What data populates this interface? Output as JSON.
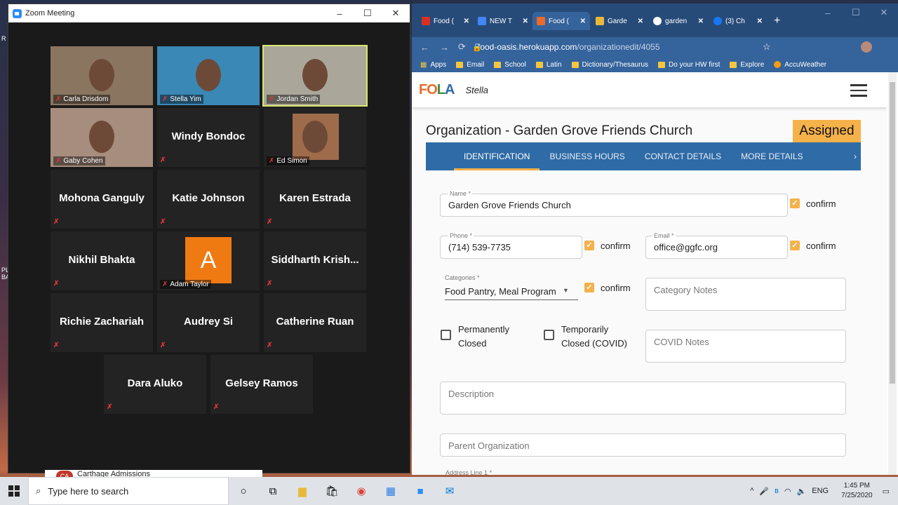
{
  "zoom": {
    "title": "Zoom Meeting",
    "participants": [
      {
        "name": "Carla Drisdom",
        "video": true
      },
      {
        "name": "Stella Yim",
        "video": true
      },
      {
        "name": "Jordan Smith",
        "video": true,
        "speaking": true
      },
      {
        "name": "Gaby Cohen",
        "video": true
      },
      {
        "name": "Windy Bondoc",
        "video": false
      },
      {
        "name": "Ed Simon",
        "video": true
      },
      {
        "name": "Mohona Ganguly",
        "video": false
      },
      {
        "name": "Katie Johnson",
        "video": false
      },
      {
        "name": "Karen Estrada",
        "video": false
      },
      {
        "name": "Nikhil Bhakta",
        "video": false
      },
      {
        "name": "Adam Taylor",
        "video": false,
        "avatar": "A"
      },
      {
        "name": "Siddharth Krish...",
        "video": false
      },
      {
        "name": "Richie Zachariah",
        "video": false
      },
      {
        "name": "Audrey Si",
        "video": false
      },
      {
        "name": "Catherine Ruan",
        "video": false
      },
      {
        "name": "Dara Aluko",
        "video": false
      },
      {
        "name": "Gelsey Ramos",
        "video": false
      }
    ]
  },
  "browser": {
    "tabs": [
      "Food (",
      "NEW T",
      "Food (",
      "Garde",
      "garden",
      "(3) Ch"
    ],
    "url_host": "food-oasis.herokuapp.com",
    "url_path": "/organizationedit/4055",
    "bookmarks": [
      "Apps",
      "Email",
      "School",
      "Latin",
      "Dictionary/Thesaurus",
      "Do your HW first",
      "Explore",
      "AccuWeather"
    ]
  },
  "app": {
    "logo": "FOLA",
    "user": "Stella",
    "page_title": "Organization - Garden Grove Friends Church",
    "status": "Assigned",
    "tabs": [
      "IDENTIFICATION",
      "BUSINESS HOURS",
      "CONTACT DETAILS",
      "MORE DETAILS"
    ],
    "name_label": "Name *",
    "name_value": "Garden Grove Friends Church",
    "phone_label": "Phone *",
    "phone_value": "(714) 539-7735",
    "email_label": "Email *",
    "email_value": "office@ggfc.org",
    "categories_label": "Categories *",
    "categories_value": "Food Pantry, Meal Program",
    "confirm": "confirm",
    "category_notes": "Category Notes",
    "perm_closed_1": "Permanently",
    "perm_closed_2": "Closed",
    "temp_closed_1": "Temporarily",
    "temp_closed_2": "Closed (COVID)",
    "covid_notes": "COVID Notes",
    "description": "Description",
    "parent_org": "Parent Organization",
    "address_label": "Address Line 1 *"
  },
  "taskbar": {
    "search": "Type here to search",
    "lang": "ENG",
    "time": "1:45 PM",
    "date": "7/25/2020"
  },
  "notification": {
    "title": "Carthage Admissions",
    "initials": "CA"
  }
}
